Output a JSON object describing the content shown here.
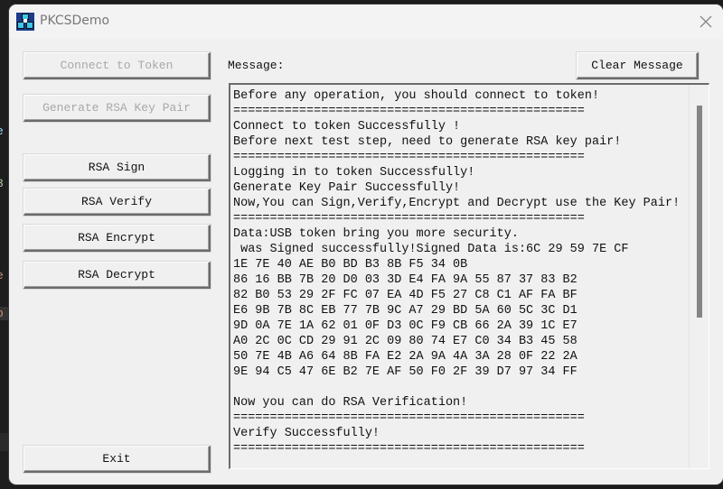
{
  "window": {
    "title": "PKCSDemo",
    "close_label": "close"
  },
  "buttons": {
    "connect": "Connect to Token",
    "generate": "Generate RSA Key Pair",
    "sign": "RSA Sign",
    "verify": "RSA Verify",
    "encrypt": "RSA Encrypt",
    "decrypt": "RSA Decrypt",
    "exit": "Exit",
    "clear": "Clear Message"
  },
  "button_states": {
    "connect_enabled": false,
    "generate_enabled": false
  },
  "message": {
    "label": "Message:",
    "lines": [
      "Before any operation, you should connect to token!",
      "================================================",
      "Connect to token Successfully !",
      "Before next test step, need to generate RSA key pair!",
      "================================================",
      "Logging in to token Successfully!",
      "Generate Key Pair Successfully!",
      "Now,You can Sign,Verify,Encrypt and Decrypt use the Key Pair!",
      "================================================",
      "Data:USB token bring you more security.",
      " was Signed successfully!Signed Data is:6C 29 59 7E CF",
      "1E 7E 40 AE B0 BD B3 8B F5 34 0B",
      "86 16 BB 7B 20 D0 03 3D E4 FA 9A 55 87 37 83 B2",
      "82 B0 53 29 2F FC 07 EA 4D F5 27 C8 C1 AF FA BF",
      "E6 9B 7B 8C EB 77 7B 9C A7 29 BD 5A 60 5C 3C D1",
      "9D 0A 7E 1A 62 01 0F D3 0C F9 CB 66 2A 39 1C E7",
      "A0 2C 0C CD 29 91 2C 09 80 74 E7 C0 34 B3 45 58",
      "50 7E 4B A6 64 8B FA E2 2A 9A 4A 3A 28 0F 22 2A",
      "9E 94 C5 47 6E B2 7E AF 50 F0 2F 39 D7 97 34 FF",
      "",
      "Now you can do RSA Verification!",
      "================================================",
      "Verify Successfully!",
      "================================================"
    ]
  },
  "icons": {
    "app": "pkcs-app-icon",
    "close": "close-icon"
  }
}
